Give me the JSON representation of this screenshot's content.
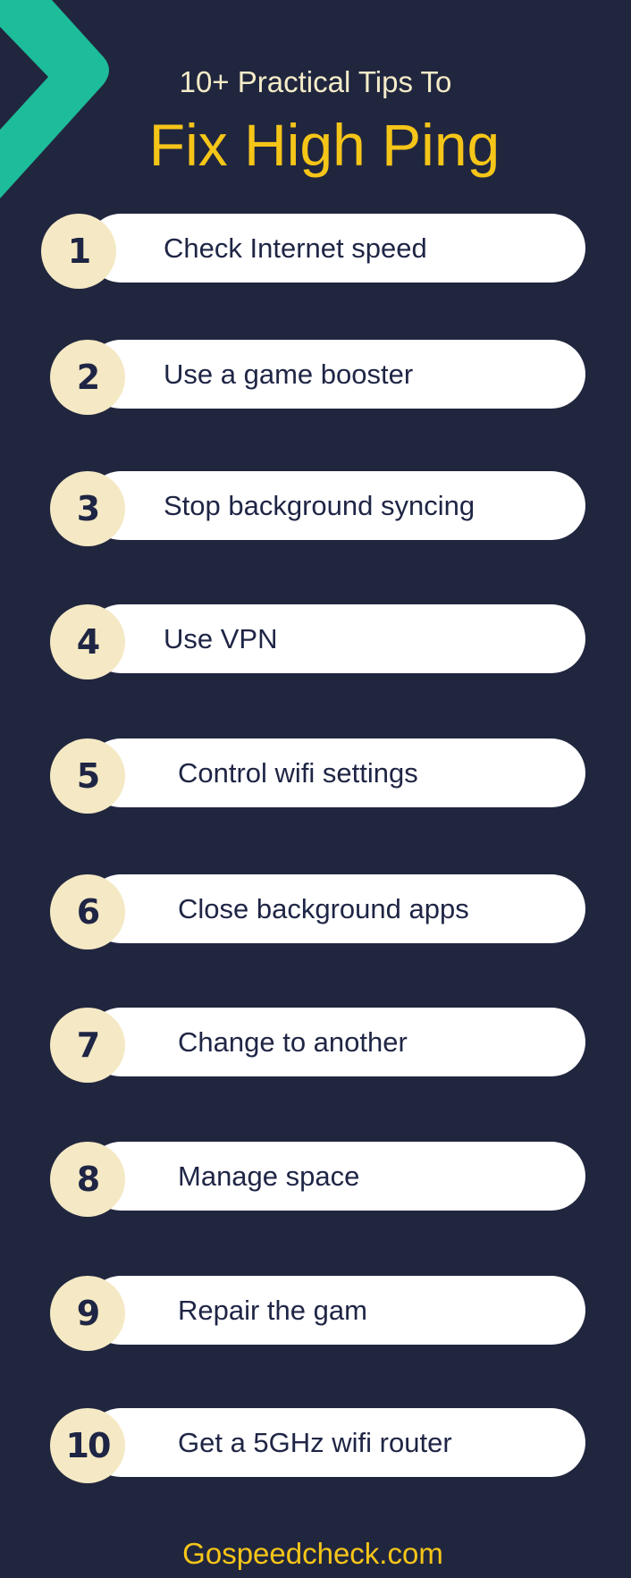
{
  "header": {
    "subtitle": "10+ Practical Tips To",
    "title": "Fix High Ping",
    "decoration_icon": "chevron-right-icon"
  },
  "colors": {
    "background": "#21263f",
    "accent_teal": "#1dbc9a",
    "title_yellow": "#f5c518",
    "subtitle_cream": "#f4ecc8",
    "badge_cream": "#f4e9c4",
    "text_navy": "#1f2545"
  },
  "tips": [
    {
      "number": "1",
      "label": "Check Internet speed"
    },
    {
      "number": "2",
      "label": "Use a game booster"
    },
    {
      "number": "3",
      "label": "Stop background syncing"
    },
    {
      "number": "4",
      "label": "Use VPN"
    },
    {
      "number": "5",
      "label": "Control wifi settings"
    },
    {
      "number": "6",
      "label": "Close background apps"
    },
    {
      "number": "7",
      "label": "Change to another"
    },
    {
      "number": "8",
      "label": "Manage space"
    },
    {
      "number": "9",
      "label": "Repair the gam"
    },
    {
      "number": "10",
      "label": "Get a 5GHz wifi router"
    }
  ],
  "footer": {
    "site": "Gospeedcheck.com"
  }
}
